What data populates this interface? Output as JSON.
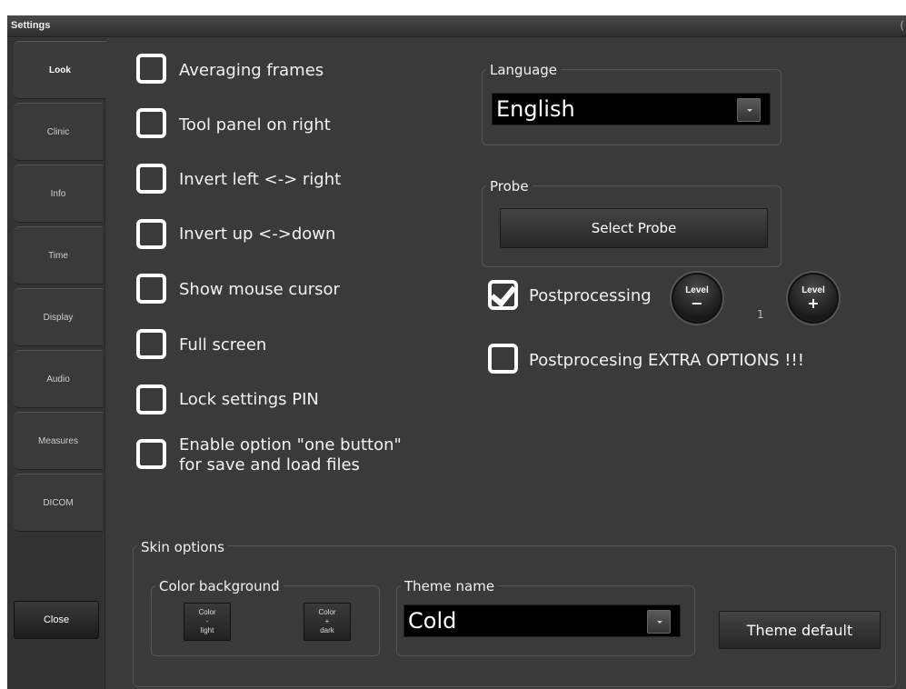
{
  "window": {
    "title": "Settings",
    "title_cap": "("
  },
  "tabs": [
    {
      "label": "Look",
      "active": true
    },
    {
      "label": "Clinic",
      "active": false
    },
    {
      "label": "Info",
      "active": false
    },
    {
      "label": "Time",
      "active": false
    },
    {
      "label": "Display",
      "active": false
    },
    {
      "label": "Audio",
      "active": false
    },
    {
      "label": "Measures",
      "active": false
    },
    {
      "label": "DICOM",
      "active": false
    }
  ],
  "close_label": "Close",
  "options": [
    {
      "label": "Averaging frames",
      "checked": false
    },
    {
      "label": "Tool panel on right",
      "checked": false
    },
    {
      "label": "Invert left <-> right",
      "checked": false
    },
    {
      "label": "Invert up <->down",
      "checked": false
    },
    {
      "label": "Show mouse cursor",
      "checked": false
    },
    {
      "label": "Full screen",
      "checked": false
    },
    {
      "label": "Lock settings PIN",
      "checked": false
    },
    {
      "label_line1": "Enable option \"one button\"",
      "label_line2": "for save and load files",
      "checked": false
    }
  ],
  "language": {
    "group_title": "Language",
    "value": "English"
  },
  "probe": {
    "group_title": "Probe",
    "button_label": "Select Probe"
  },
  "postprocessing": {
    "label": "Postprocessing",
    "checked": true,
    "level_value": "1",
    "level_minus": {
      "label": "Level",
      "sign": "−"
    },
    "level_plus": {
      "label": "Level",
      "sign": "+"
    }
  },
  "extra_options": {
    "label": "Postprocesing EXTRA OPTIONS !!!",
    "checked": false
  },
  "skin": {
    "group_title": "Skin options",
    "color_background": {
      "group_title": "Color background",
      "light_button": {
        "line1": "Color",
        "line2": "-",
        "line3": "light"
      },
      "dark_button": {
        "line1": "Color",
        "line2": "+",
        "line3": "dark"
      }
    },
    "theme": {
      "group_title": "Theme name",
      "value": "Cold"
    },
    "theme_default_label": "Theme default"
  }
}
